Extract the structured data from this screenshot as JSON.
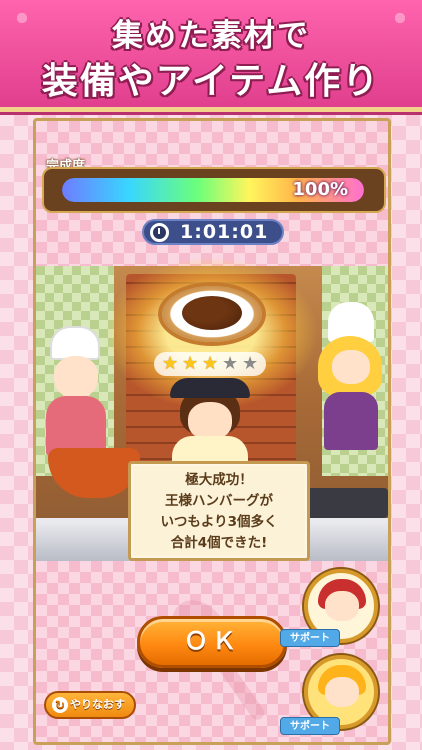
{
  "header": {
    "line1": "集めた素材で",
    "line2": "装備やアイテム作り"
  },
  "progress": {
    "label": "完成度",
    "percent_text": "100%",
    "value": 1.0
  },
  "timer": {
    "text": "1:01:01",
    "icon": "stopwatch-icon"
  },
  "result": {
    "stars_filled": 3,
    "stars_total": 5,
    "message_lines": [
      "極大成功！",
      "王様ハンバーグが",
      "いつもより3個多く",
      "合計4個できた!"
    ]
  },
  "buttons": {
    "ok_label": "ＯＫ",
    "retry_label": "やりなおす"
  },
  "support": {
    "tag_label": "サポート"
  },
  "colors": {
    "banner": "#e03f8e",
    "button_orange": "#ff8a12",
    "support_tag": "#52a9e8"
  }
}
